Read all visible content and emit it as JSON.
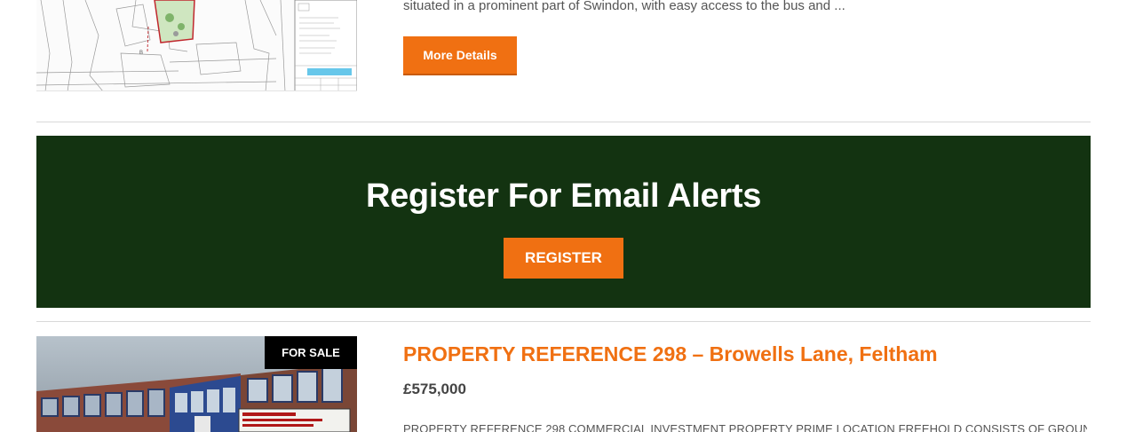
{
  "previous_listing": {
    "excerpt": "situated in a prominent part of Swindon, with easy access to the bus and ...",
    "more_details_label": "More Details"
  },
  "email_alerts": {
    "title": "Register For Email Alerts",
    "register_label": "REGISTER"
  },
  "listing": {
    "badge": "FOR SALE",
    "title": "PROPERTY REFERENCE 298 – Browells Lane, Feltham",
    "price": "£575,000",
    "excerpt": "PROPERTY REFERENCE 298 COMMERCIAL INVESTMENT PROPERTY PRIME LOCATION FREEHOLD CONSISTS OF GROUND"
  },
  "colors": {
    "accent": "#f07012",
    "banner": "#133311",
    "badge": "#000000"
  }
}
